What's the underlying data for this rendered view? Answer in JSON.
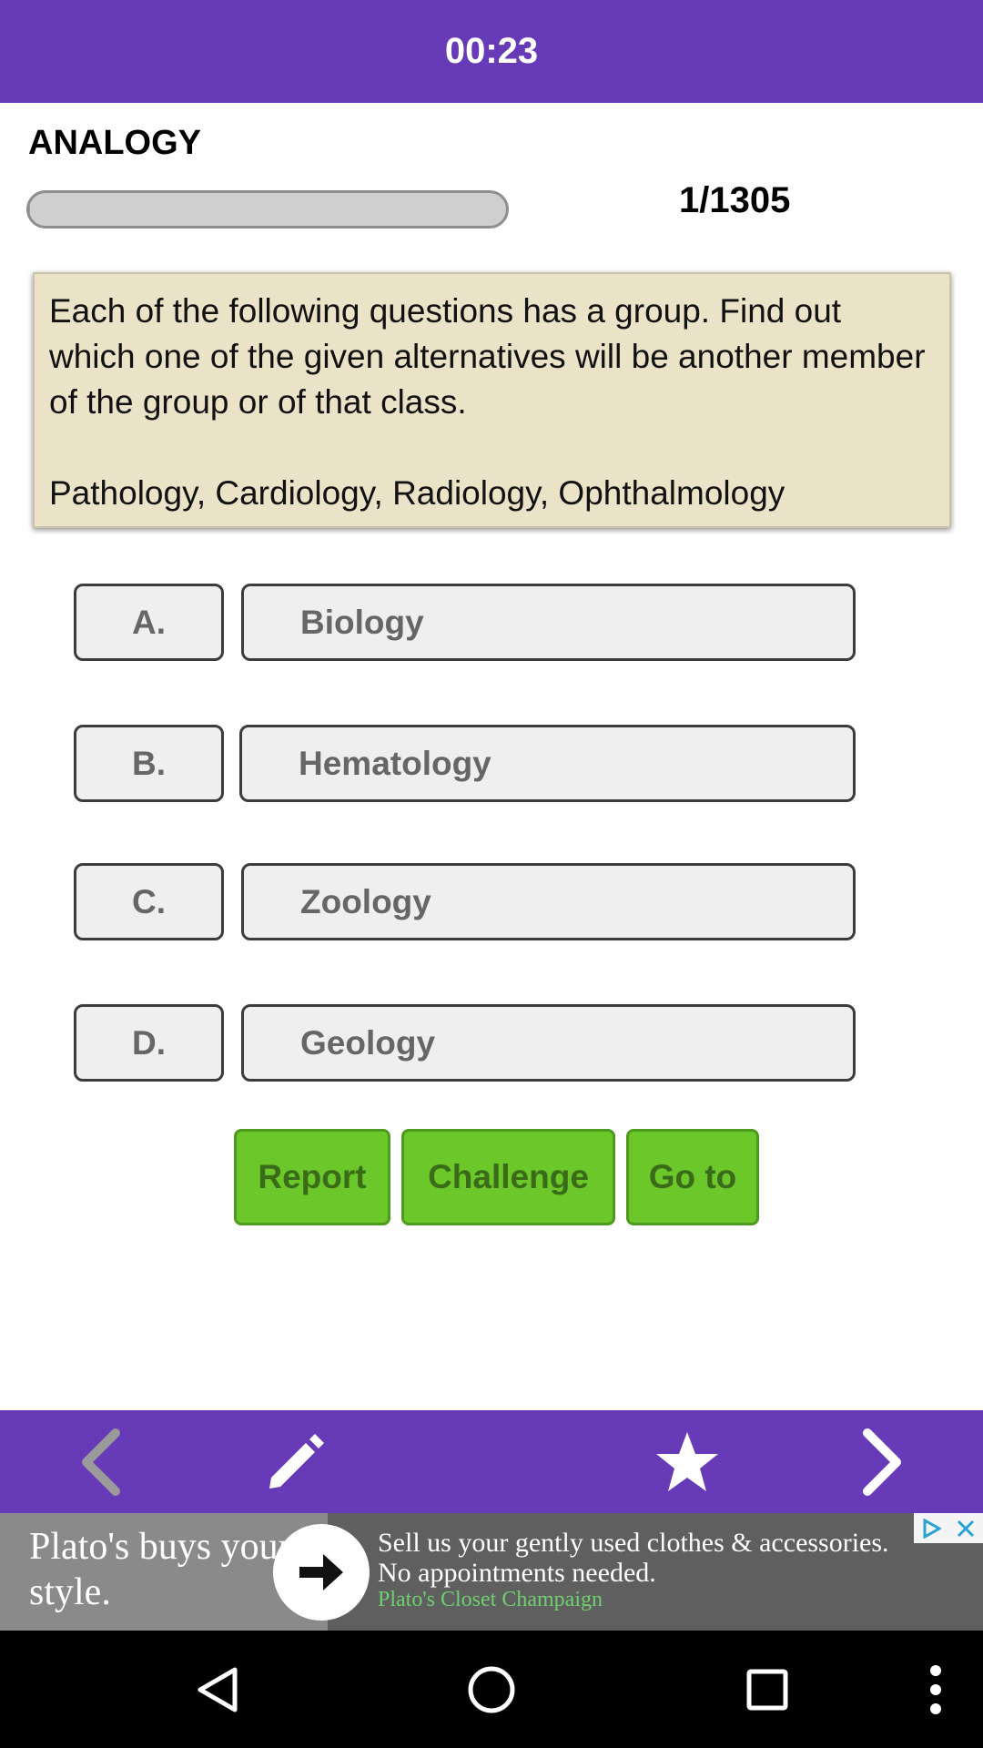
{
  "header": {
    "timer": "00:23"
  },
  "quiz": {
    "category": "ANALOGY",
    "progress_fraction": 0.0008,
    "counter": "1/1305",
    "question": "Each of the following questions has a group. Find out which one of the given alternatives will be another member of the group or of that class.\n\nPathology, Cardiology, Radiology, Ophthalmology"
  },
  "options": [
    {
      "letter": "A.",
      "text": "Biology"
    },
    {
      "letter": "B.",
      "text": "Hematology"
    },
    {
      "letter": "C.",
      "text": "Zoology"
    },
    {
      "letter": "D.",
      "text": "Geology"
    }
  ],
  "actions": {
    "report": "Report",
    "challenge": "Challenge",
    "goto": "Go to"
  },
  "bottom_nav": {
    "icons": [
      "chevron-left-icon",
      "pencil-icon",
      "star-icon",
      "chevron-right-icon"
    ]
  },
  "ad": {
    "left_text": "Plato's buys your style.",
    "body": "Sell us your gently used clothes & accessories. No appointments needed.",
    "advertiser": "Plato's Closet Champaign",
    "icons": [
      "arrow-right-icon",
      "adchoices-icon",
      "close-icon"
    ]
  },
  "system_nav": {
    "icons": [
      "back-icon",
      "home-icon",
      "recents-icon",
      "more-icon"
    ]
  },
  "colors": {
    "accent": "#673ab7",
    "question_bg": "#ebe3c8",
    "button_green": "#6cc82a",
    "option_bg": "#efefef"
  }
}
